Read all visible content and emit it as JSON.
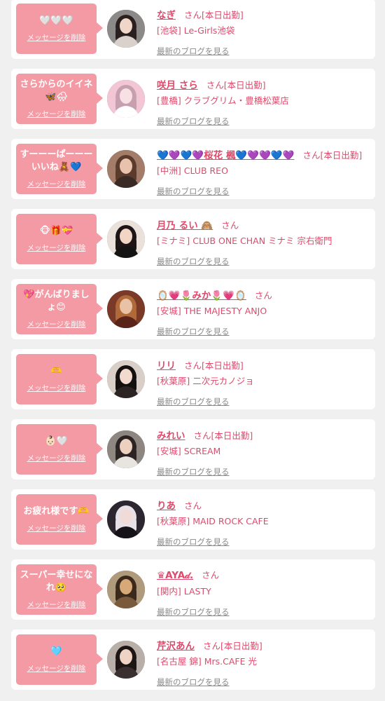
{
  "delete_label": "メッセージを削除",
  "blog_label": "最新のブログを見る",
  "san_label": "さん",
  "colors": {
    "background": "#f1f0f0",
    "bubble": "#f49aa4",
    "accent": "#dd4a6c",
    "link_gray": "#8b8b8b"
  },
  "cards": [
    {
      "message": "🤍🤍🤍",
      "name": "なぎ",
      "status": "[本日出勤]",
      "store": "[池袋] Le-Girls池袋",
      "avatar": {
        "bg": "#8c8a88",
        "hair": "#2a2020",
        "skin": "#f0d6c8",
        "top": "#d9d2cc"
      }
    },
    {
      "message": "さらからのイイネ🦋🌧",
      "name": "咲月 さら",
      "status": "[本日出勤]",
      "store": "[豊橋] クラブグリム・豊橋松葉店",
      "avatar": {
        "bg": "#f3c6d6",
        "hair": "#c7a0b0",
        "skin": "#f7e1e5",
        "top": "#ffffff"
      }
    },
    {
      "message": "すーーーぱーーーいいね🧸💙",
      "name": "💙💜💙💜桜花 楓💙💜💜💙💜",
      "status": "[本日出勤]",
      "store": "[中洲] CLUB REO",
      "avatar": {
        "bg": "#a37c6a",
        "hair": "#5b3b2c",
        "skin": "#e8c2ad",
        "top": "#3a2a26"
      }
    },
    {
      "message": "🐵🎁💝",
      "name": "月乃 るい 🙈",
      "status": "",
      "store": "[ミナミ] CLUB ONE CHAN ミナミ 宗右衛門",
      "avatar": {
        "bg": "#e9e1da",
        "hair": "#1e1616",
        "skin": "#f1d6c6",
        "top": "#141414"
      }
    },
    {
      "message": "💖がんばりましょ😊",
      "name": "🪞💗🌷みか🌷💗🪞",
      "status": "",
      "store": "[安城] THE MAJESTY ANJO",
      "avatar": {
        "bg": "#7b3a28",
        "hair": "#b06a3a",
        "skin": "#e9c2a6",
        "top": "#5a2418"
      }
    },
    {
      "message": "🫶",
      "name": "リリ",
      "status": "[本日出勤]",
      "store": "[秋葉原] 二次元カノジョ",
      "avatar": {
        "bg": "#d9cfc8",
        "hair": "#141010",
        "skin": "#f3dace",
        "top": "#2c2424"
      }
    },
    {
      "message": "👶🏻🤍",
      "name": "みれい",
      "status": "[本日出勤]",
      "store": "[安城] SCREAM",
      "avatar": {
        "bg": "#8e8680",
        "hair": "#2c2422",
        "skin": "#ecd0c0",
        "top": "#e8e4e0"
      }
    },
    {
      "message": "お疲れ様です🫶",
      "name": "りあ",
      "status": "",
      "store": "[秋葉原] MAID ROCK CAFE",
      "avatar": {
        "bg": "#2c2630",
        "hair": "#e7e0e6",
        "skin": "#f1dbd6",
        "top": "#151218"
      }
    },
    {
      "message": "スーパー幸せになれ🥺",
      "name": "♛AYA𝒹.",
      "status": "",
      "store": "[関内] LASTY",
      "avatar": {
        "bg": "#b09a7c",
        "hair": "#3b2a1c",
        "skin": "#d8a978",
        "top": "#7a5a3c"
      }
    },
    {
      "message": "🩵",
      "name": "芹沢あん",
      "status": "[本日出勤]",
      "store": "[名古屋 錦] Mrs.CAFE 光",
      "avatar": {
        "bg": "#b8b0a8",
        "hair": "#1d1614",
        "skin": "#efd3c4",
        "top": "#3a3030"
      }
    }
  ]
}
